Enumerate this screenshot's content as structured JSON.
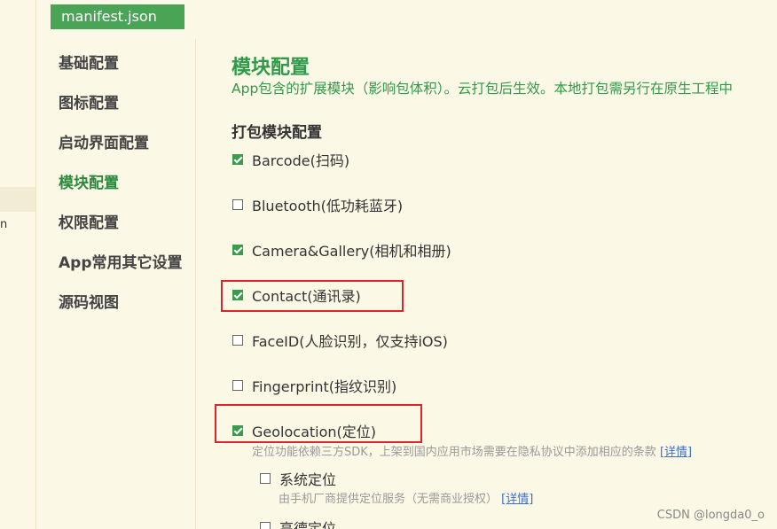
{
  "editor": {
    "file_tab": "manifest.json",
    "left_fragment": "n"
  },
  "nav": {
    "items": [
      {
        "label": "基础配置",
        "active": false
      },
      {
        "label": "图标配置",
        "active": false
      },
      {
        "label": "启动界面配置",
        "active": false
      },
      {
        "label": "模块配置",
        "active": true
      },
      {
        "label": "权限配置",
        "active": false
      },
      {
        "label": "App常用其它设置",
        "active": false
      },
      {
        "label": "源码视图",
        "active": false
      }
    ]
  },
  "main": {
    "title": "模块配置",
    "subtitle": "App包含的扩展模块（影响包体积）。云打包后生效。本地打包需另行在原生工程中",
    "section_title": "打包模块配置",
    "modules": [
      {
        "label": "Barcode(扫码)",
        "checked": true
      },
      {
        "label": "Bluetooth(低功耗蓝牙)",
        "checked": false
      },
      {
        "label": "Camera&Gallery(相机和相册)",
        "checked": true
      },
      {
        "label": "Contact(通讯录)",
        "checked": true
      },
      {
        "label": "FaceID(人脸识别，仅支持iOS)",
        "checked": false
      },
      {
        "label": "Fingerprint(指纹识别)",
        "checked": false
      },
      {
        "label": "Geolocation(定位)",
        "checked": true
      }
    ],
    "geolocation_note": "定位功能依赖三方SDK，上架到国内应用市场需要在隐私协议中添加相应的条款",
    "details_link": "[详情]",
    "sub_options": [
      {
        "label": "系统定位",
        "checked": false,
        "note": "由手机厂商提供定位服务（无需商业授权）",
        "link": "[详情]"
      },
      {
        "label": "高德定位",
        "checked": false
      }
    ]
  },
  "watermark": "CSDN @longda0_o",
  "colors": {
    "background": "#fcf8e6",
    "accent_green": "#2e9a4a",
    "tab_green": "#4aa456",
    "highlight_red": "#e0242c",
    "link_blue": "#3a6fd1"
  }
}
